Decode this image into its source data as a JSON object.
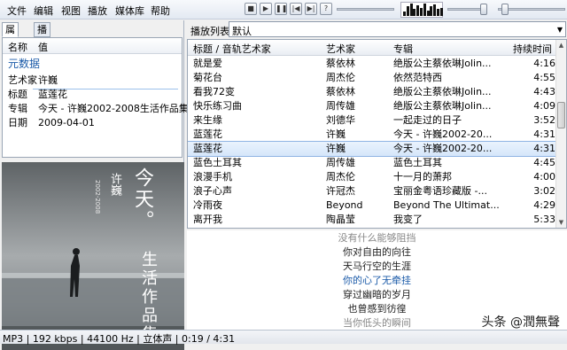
{
  "menu": [
    "文件",
    "编辑",
    "视图",
    "播放",
    "媒体库",
    "帮助"
  ],
  "transport_icons": [
    "stop-icon",
    "play-icon",
    "pause-icon",
    "previous-icon",
    "next-icon",
    "random-icon"
  ],
  "left_tabs": [
    "属性",
    "播放列表"
  ],
  "props": {
    "headers": [
      "名称",
      "值"
    ],
    "group": "元数据",
    "rows": [
      {
        "k": "艺术家",
        "v": "许巍"
      },
      {
        "k": "标题",
        "v": "蓝莲花"
      },
      {
        "k": "专辑",
        "v": "今天 - 许巍2002-2008生活作品集"
      },
      {
        "k": "日期",
        "v": "2009-04-01"
      }
    ]
  },
  "album_art": {
    "big": "今天。",
    "artist": "许巍",
    "subtitle": "生活作品集",
    "years": "2002-2008"
  },
  "playlist_selector": {
    "label": "播放列表:",
    "value": "默认"
  },
  "columns": [
    "标题 / 音轨艺术家",
    "艺术家",
    "专辑",
    "持续时间"
  ],
  "tracks": [
    {
      "title": "就是爱",
      "artist": "蔡依林",
      "album": "绝版公主蔡依琳Jolin...",
      "time": "4:16"
    },
    {
      "title": "菊花台",
      "artist": "周杰伦",
      "album": "依然范特西",
      "time": "4:55"
    },
    {
      "title": "看我72变",
      "artist": "蔡依林",
      "album": "绝版公主蔡依琳Jolin...",
      "time": "4:43"
    },
    {
      "title": "快乐练习曲",
      "artist": "周传雄",
      "album": "绝版公主蔡依琳Jolin...",
      "time": "4:09"
    },
    {
      "title": "来生缘",
      "artist": "刘德华",
      "album": "一起走过的日子",
      "time": "3:52"
    },
    {
      "title": "蓝莲花",
      "artist": "许巍",
      "album": "今天 - 许巍2002-20...",
      "time": "4:31"
    },
    {
      "title": "蓝莲花",
      "artist": "许巍",
      "album": "今天 - 许巍2002-20...",
      "time": "4:31"
    },
    {
      "title": "蓝色土耳其",
      "artist": "周传雄",
      "album": "蓝色土耳其",
      "time": "4:45"
    },
    {
      "title": "浪漫手机",
      "artist": "周杰伦",
      "album": "十一月的萧邦",
      "time": "4:00"
    },
    {
      "title": "浪子心声",
      "artist": "许冠杰",
      "album": "宝丽金粤语珍藏版 -...",
      "time": "3:02"
    },
    {
      "title": "冷雨夜",
      "artist": "Beyond",
      "album": "Beyond The Ultimat...",
      "time": "4:29"
    },
    {
      "title": "离开我",
      "artist": "陶晶莹",
      "album": "我变了",
      "time": "5:33"
    }
  ],
  "selected_index": 6,
  "lyrics": [
    {
      "text": "没有什么能够阻挡",
      "current": false
    },
    {
      "text": "你对自由的向往",
      "current": false
    },
    {
      "text": "天马行空的生涯",
      "current": false
    },
    {
      "text": "你的心了无牵挂",
      "current": true
    },
    {
      "text": "穿过幽暗的岁月",
      "current": false
    },
    {
      "text": "也曾感到彷徨",
      "current": false
    },
    {
      "text": "当你低头的瞬间",
      "current": false
    }
  ],
  "status": "MP3 | 192 kbps | 44100 Hz | 立体声 | 0:19 / 4:31",
  "watermark": "头条 @潤無聲",
  "viz_levels": [
    0.3,
    0.7,
    0.9,
    0.5,
    0.8,
    0.6,
    0.95,
    0.4,
    0.7,
    0.85,
    0.5,
    0.6
  ]
}
